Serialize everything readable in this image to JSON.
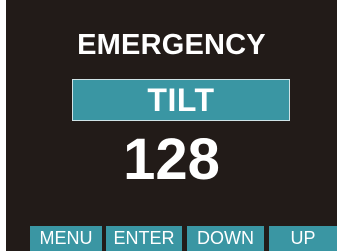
{
  "display": {
    "title": "EMERGENCY",
    "mode": "TILT",
    "value": "128"
  },
  "softkeys": [
    {
      "label": "MENU"
    },
    {
      "label": "ENTER"
    },
    {
      "label": "DOWN"
    },
    {
      "label": "UP"
    }
  ],
  "colors": {
    "screen_background": "#221b18",
    "accent": "#3a96a3",
    "text": "#ffffff"
  }
}
